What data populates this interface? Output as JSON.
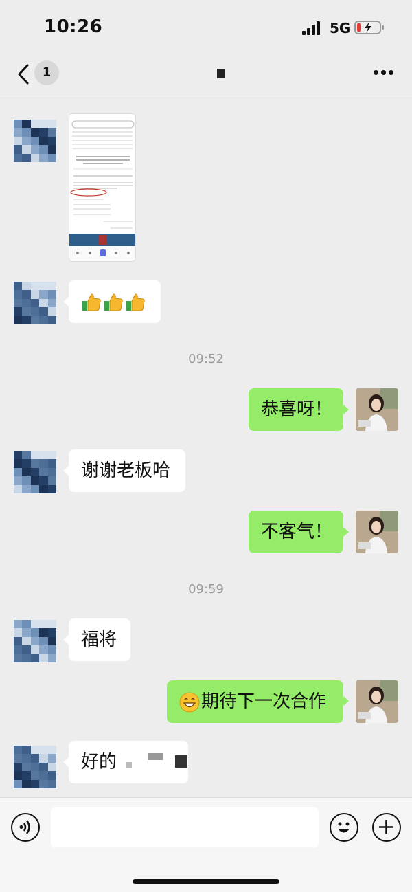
{
  "status_bar": {
    "time": "10:26",
    "network": "5G",
    "signal-icon": "signal-icon",
    "battery-icon": "battery-low-charging-icon"
  },
  "nav": {
    "unread_count": "1",
    "back_icon": "chevron-left-icon",
    "more_icon": "more-icon"
  },
  "messages": [
    {
      "sender": "other",
      "type": "image"
    },
    {
      "sender": "other",
      "type": "emoji",
      "emoji": [
        "thumbs-up",
        "thumbs-up",
        "thumbs-up"
      ]
    },
    {
      "type": "timestamp",
      "text": "09:52"
    },
    {
      "sender": "me",
      "type": "text",
      "text": "恭喜呀！"
    },
    {
      "sender": "other",
      "type": "text",
      "text": "谢谢老板哈"
    },
    {
      "sender": "me",
      "type": "text",
      "text": "不客气！"
    },
    {
      "type": "timestamp",
      "text": "09:59"
    },
    {
      "sender": "other",
      "type": "text",
      "text": "福将"
    },
    {
      "sender": "me",
      "type": "text",
      "emoji": "grin-face",
      "text": "期待下一次合作"
    },
    {
      "sender": "other",
      "type": "text",
      "text": "好的"
    }
  ],
  "colors": {
    "background": "#ededed",
    "my_bubble": "#95ec69",
    "other_bubble": "#ffffff"
  }
}
